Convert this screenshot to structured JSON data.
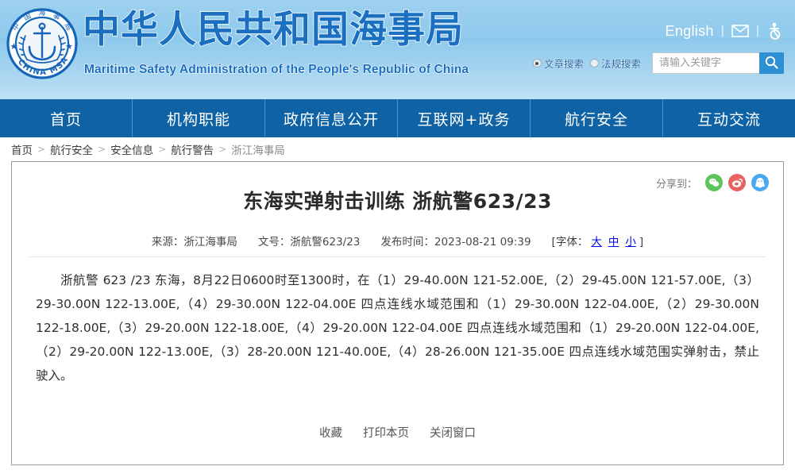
{
  "header": {
    "logo_alt": "CHINA MSA",
    "logo_ring_text": "CHINA MSA",
    "logo_inner_text": "中国海事局",
    "title_cn": "中华人民共和国海事局",
    "title_en": "Maritime Safety Administration of the People's Republic of China",
    "english_link": "English",
    "separator": "|",
    "mail_icon": "mail-icon",
    "accessibility_icon": "accessibility-icon",
    "search": {
      "options": [
        {
          "label": "文章搜索",
          "checked": true
        },
        {
          "label": "法规搜索",
          "checked": false
        }
      ],
      "placeholder": "请输入关键字",
      "value": "",
      "button_icon": "search-icon"
    }
  },
  "nav": {
    "items": [
      {
        "label": "首页"
      },
      {
        "label": "机构职能"
      },
      {
        "label": "政府信息公开"
      },
      {
        "label": "互联网+政务"
      },
      {
        "label": "航行安全"
      },
      {
        "label": "互动交流"
      }
    ]
  },
  "breadcrumb": {
    "separator": ">",
    "items": [
      {
        "label": "首页"
      },
      {
        "label": "航行安全"
      },
      {
        "label": "安全信息"
      },
      {
        "label": "航行警告"
      },
      {
        "label": "浙江海事局"
      }
    ]
  },
  "article": {
    "share_label": "分享到：",
    "share_icons": [
      {
        "name": "wechat-share-icon",
        "color": "#5cc55c",
        "glyph": "✉"
      },
      {
        "name": "weibo-share-icon",
        "color": "#e8635f",
        "glyph": "◉"
      },
      {
        "name": "qq-share-icon",
        "color": "#4aa8ef",
        "glyph": "●"
      }
    ],
    "title": "东海实弹射击训练 浙航警623/23",
    "meta": {
      "source_label": "来源：",
      "source_value": "浙江海事局",
      "doc_no_label": "文号：",
      "doc_no_value": "浙航警623/23",
      "publish_label": "发布时间：",
      "publish_value": "2023-08-21 09:39",
      "font_bracket_open": "[字体：",
      "font_large": "大",
      "font_medium": "中",
      "font_small": "小",
      "font_bracket_close": "]"
    },
    "body": "浙航警  623 /23 东海，8月22日0600时至1300时，在（1）29-40.00N 121-52.00E,（2）29-45.00N 121-57.00E,（3）29-30.00N 122-13.00E,（4）29-30.00N 122-04.00E 四点连线水域范围和（1）29-30.00N 122-04.00E,（2）29-30.00N 122-18.00E,（3）29-20.00N 122-18.00E,（4）29-20.00N 122-04.00E 四点连线水域范围和（1）29-20.00N 122-04.00E,（2）29-20.00N 122-13.00E,（3）28-20.00N 121-40.00E,（4）28-26.00N 121-35.00E 四点连线水域范围实弹射击，禁止驶入。",
    "actions": [
      {
        "label": "收藏",
        "name": "favorite-link"
      },
      {
        "label": "打印本页",
        "name": "print-link"
      },
      {
        "label": "关闭窗口",
        "name": "close-window-link"
      }
    ]
  },
  "colors": {
    "header_gradient_top": "#9ed0ef",
    "header_gradient_bottom": "#bfe0f4",
    "nav_bg": "#0f63a4",
    "brand_blue": "#1a6fc0",
    "search_btn": "#2e90d2"
  }
}
